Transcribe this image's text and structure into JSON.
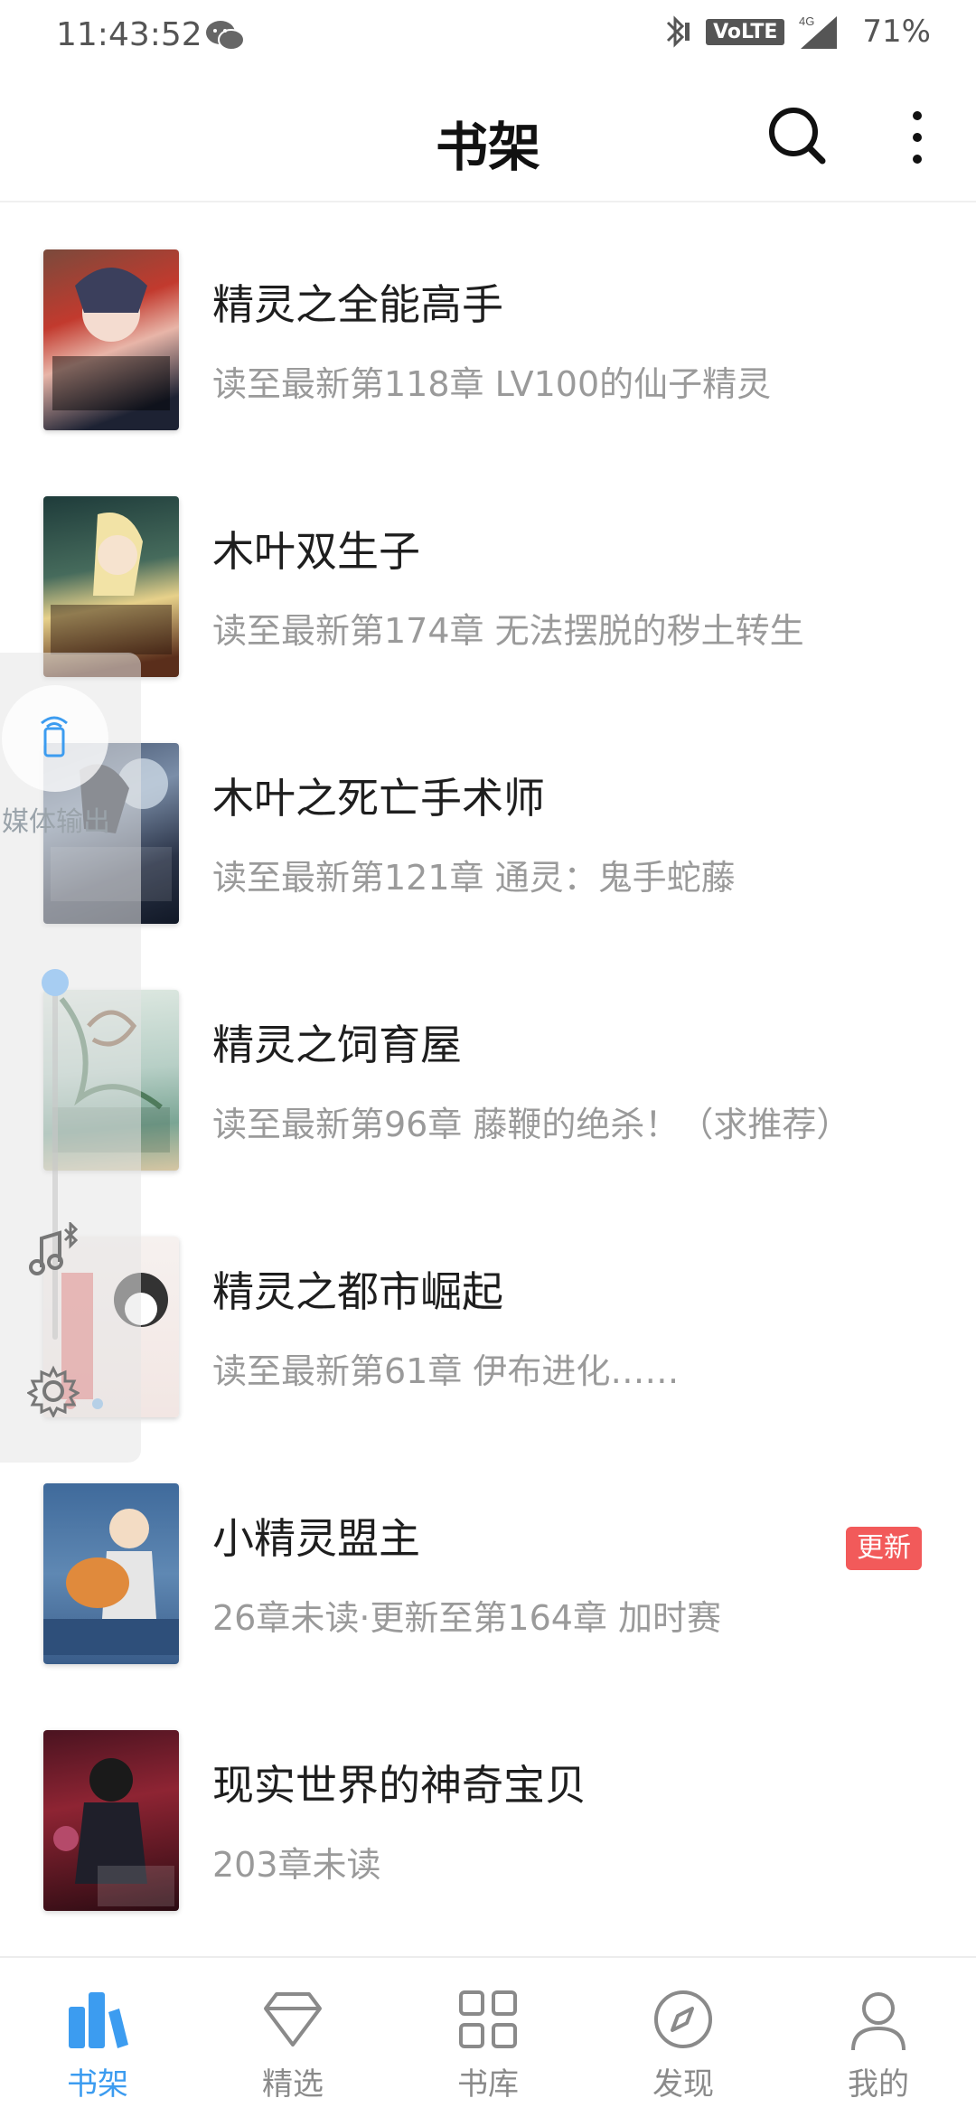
{
  "status_bar": {
    "time": "11:43:52",
    "volte": "VoLTE",
    "network": "4G",
    "battery": "71%"
  },
  "header": {
    "title": "书架",
    "search_icon": "search-icon",
    "more_icon": "more-vertical-icon"
  },
  "books": [
    {
      "title": "精灵之全能高手",
      "subtitle": "读至最新第118章 LV100的仙子精灵",
      "badge": ""
    },
    {
      "title": "木叶双生子",
      "subtitle": "读至最新第174章 无法摆脱的秽土转生",
      "badge": ""
    },
    {
      "title": "木叶之死亡手术师",
      "subtitle": "读至最新第121章 通灵：鬼手蛇藤",
      "badge": ""
    },
    {
      "title": "精灵之饲育屋",
      "subtitle": "读至最新第96章 藤鞭的绝杀！（求推荐）",
      "badge": ""
    },
    {
      "title": "精灵之都市崛起",
      "subtitle": "读至最新第61章 伊布进化……",
      "badge": ""
    },
    {
      "title": "小精灵盟主",
      "subtitle": "26章未读·更新至第164章 加时赛",
      "badge": "更新"
    },
    {
      "title": "现实世界的神奇宝贝",
      "subtitle": "203章未读",
      "badge": ""
    }
  ],
  "media_panel": {
    "label": "媒体输出"
  },
  "bottom_nav": [
    {
      "label": "书架",
      "icon": "bookshelf-icon",
      "active": true
    },
    {
      "label": "精选",
      "icon": "diamond-icon",
      "active": false
    },
    {
      "label": "书库",
      "icon": "grid-icon",
      "active": false
    },
    {
      "label": "发现",
      "icon": "compass-icon",
      "active": false
    },
    {
      "label": "我的",
      "icon": "profile-icon",
      "active": false
    }
  ],
  "colors": {
    "accent": "#3c9cf0",
    "badge": "#f25a5a",
    "subtitle": "#9a9a9a"
  }
}
